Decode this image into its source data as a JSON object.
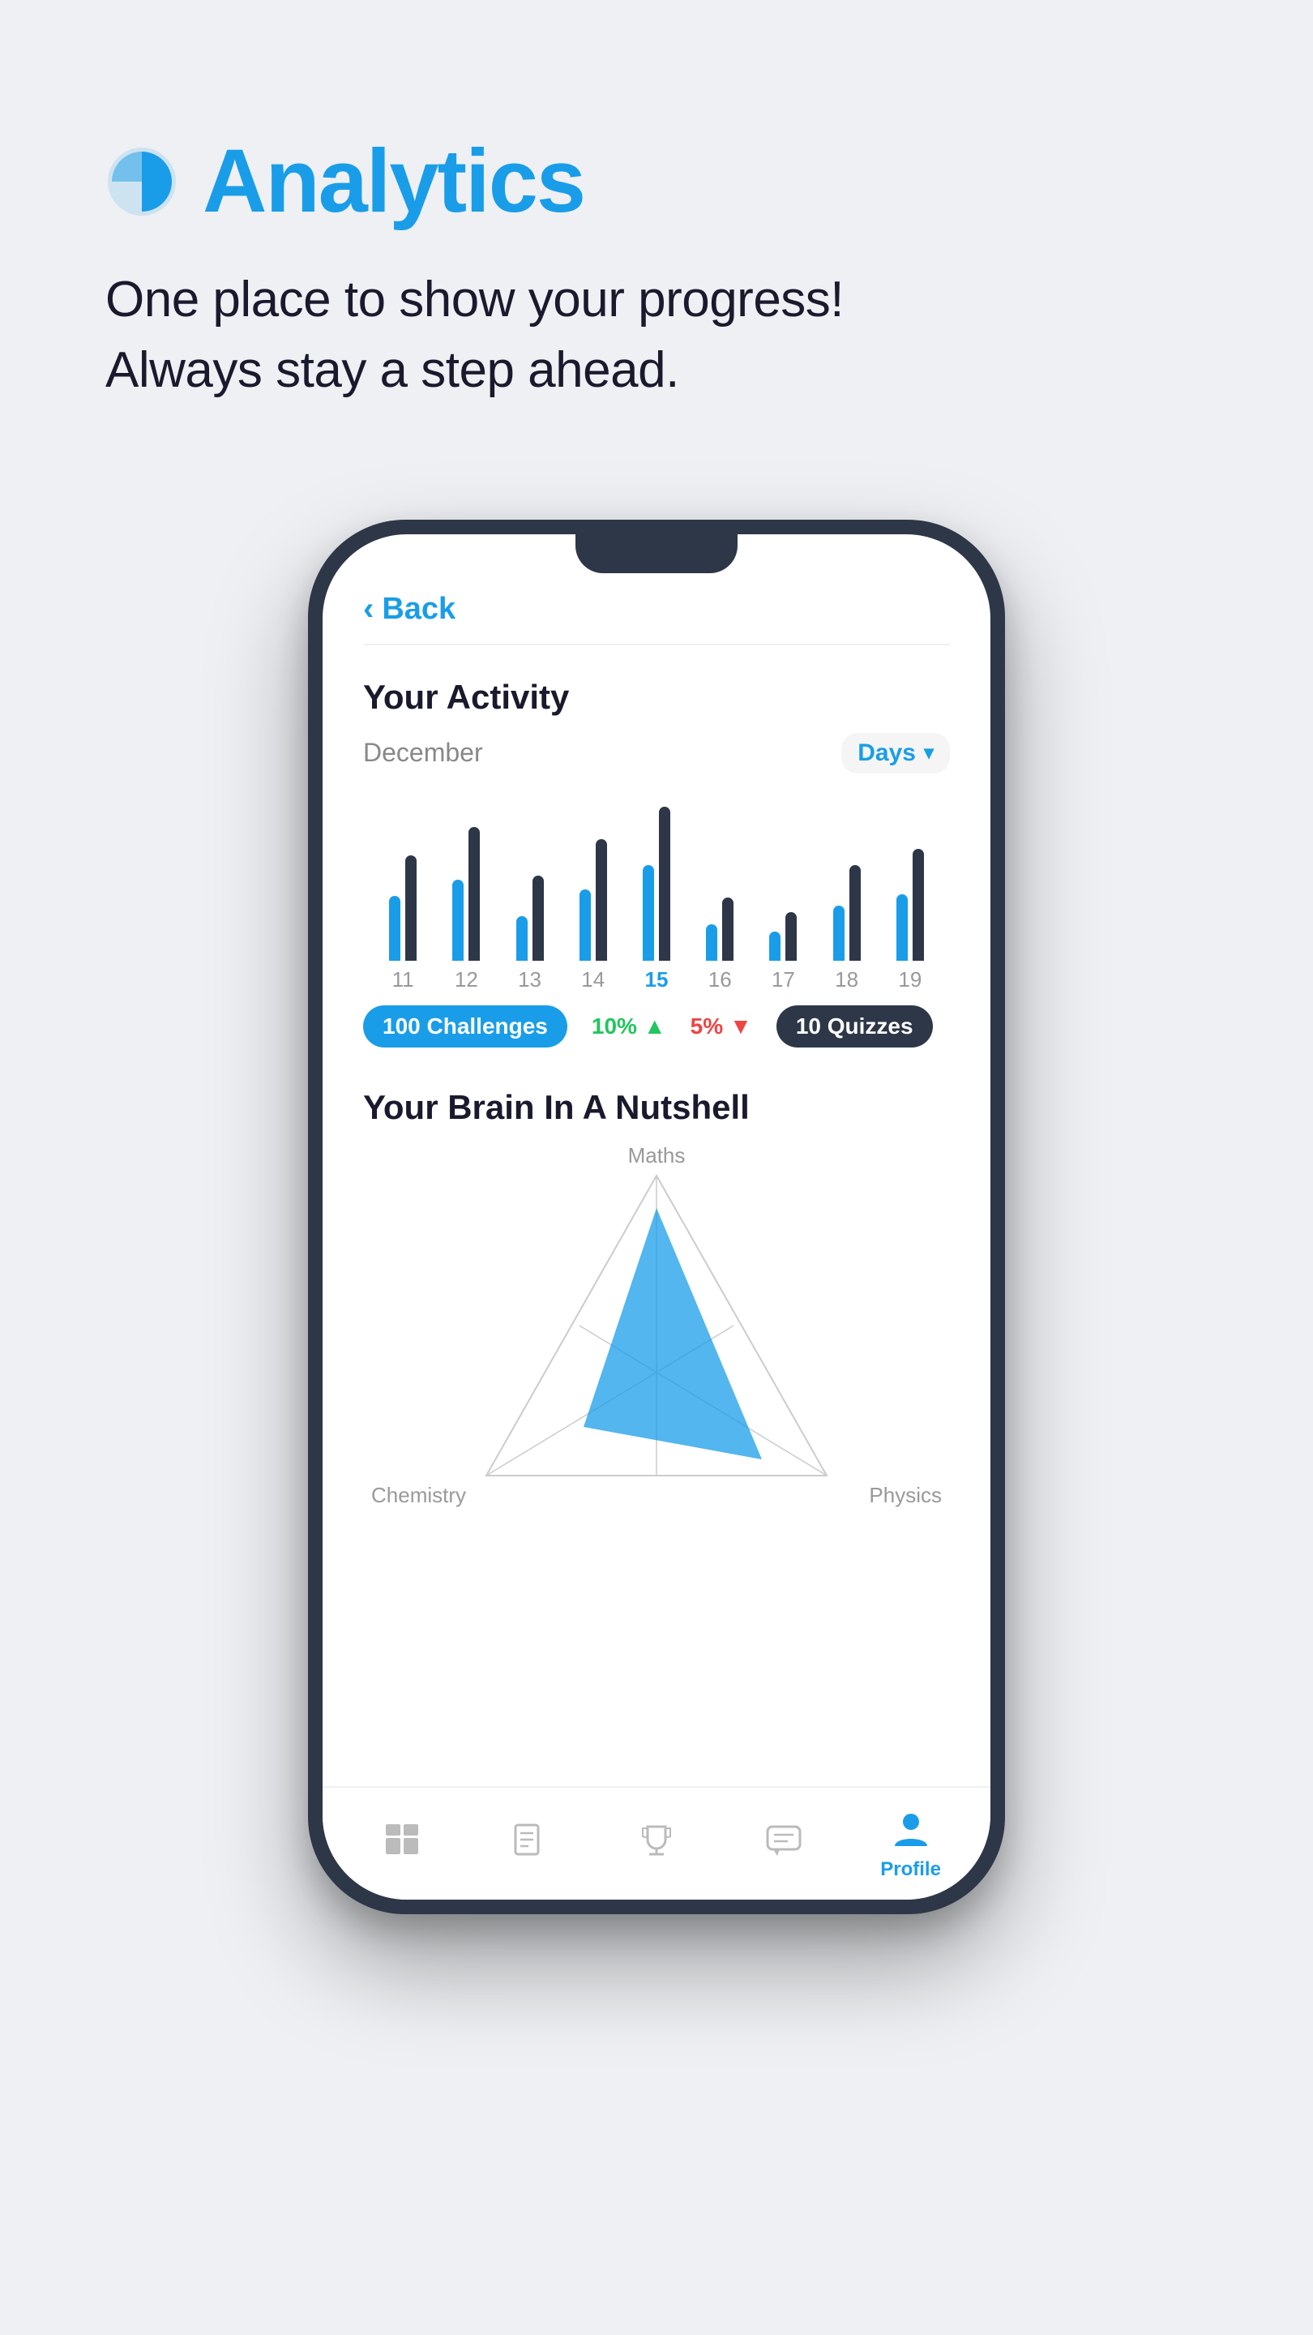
{
  "header": {
    "icon_label": "analytics-pie-icon",
    "title": "Analytics",
    "subtitle_line1": "One place to show your progress!",
    "subtitle_line2": "Always stay a step ahead."
  },
  "phone": {
    "back_button": "Back",
    "activity": {
      "title": "Your Activity",
      "month": "December",
      "filter": "Days",
      "bars": [
        {
          "day": "11",
          "heights": [
            80,
            130
          ],
          "active": false
        },
        {
          "day": "12",
          "heights": [
            100,
            170
          ],
          "active": false
        },
        {
          "day": "13",
          "heights": [
            60,
            110
          ],
          "active": false
        },
        {
          "day": "14",
          "heights": [
            90,
            155
          ],
          "active": false
        },
        {
          "day": "15",
          "heights": [
            120,
            190
          ],
          "active": true
        },
        {
          "day": "16",
          "heights": [
            50,
            80
          ],
          "active": false
        },
        {
          "day": "17",
          "heights": [
            40,
            65
          ],
          "active": false
        },
        {
          "day": "18",
          "heights": [
            70,
            120
          ],
          "active": false
        },
        {
          "day": "19",
          "heights": [
            85,
            140
          ],
          "active": false
        }
      ],
      "badge1": "100 Challenges",
      "stat1": "10%",
      "stat1_direction": "up",
      "stat2": "5%",
      "stat2_direction": "down",
      "badge2": "10 Quizzes"
    },
    "brain": {
      "title": "Your Brain In A Nutshell",
      "labels": {
        "top": "Maths",
        "bottom_left": "Chemistry",
        "bottom_right": "Physics"
      }
    },
    "nav": {
      "items": [
        {
          "label": "Home",
          "active": false
        },
        {
          "label": "Study",
          "active": false
        },
        {
          "label": "Trophy",
          "active": false
        },
        {
          "label": "Chat",
          "active": false
        },
        {
          "label": "Profile",
          "active": true
        }
      ]
    }
  }
}
